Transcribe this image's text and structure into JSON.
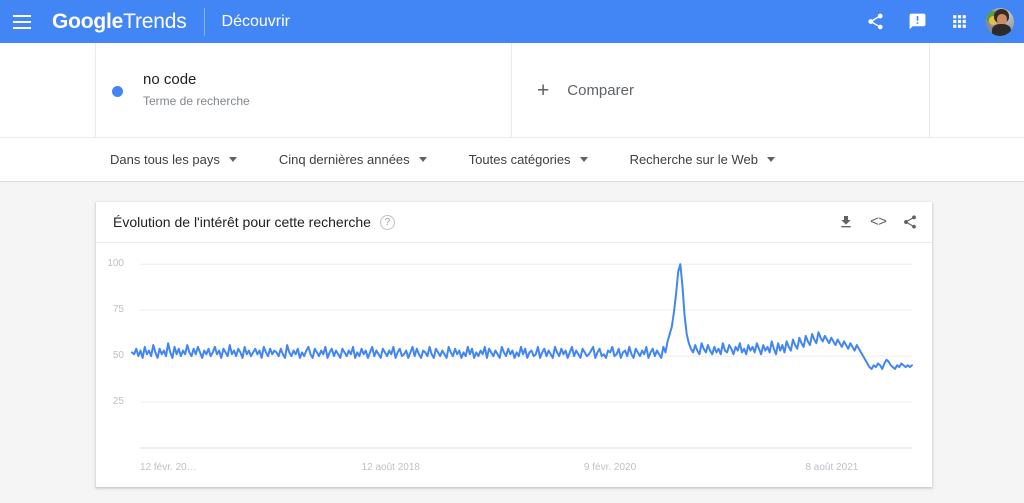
{
  "header": {
    "menu_icon": "hamburger-menu-icon",
    "brand_bold": "Google",
    "brand_light": "Trends",
    "discover_label": "Découvrir",
    "share_icon": "share-icon",
    "feedback_icon": "feedback-icon",
    "apps_icon": "apps-grid-icon",
    "avatar_icon": "user-avatar",
    "background_color": "#4285f4"
  },
  "search_term": {
    "title": "no code",
    "subtitle": "Terme de recherche",
    "dot_color": "#4285f4"
  },
  "compare": {
    "plus": "+",
    "label": "Comparer"
  },
  "filters": [
    {
      "label": "Dans tous les pays"
    },
    {
      "label": "Cinq dernières années"
    },
    {
      "label": "Toutes catégories"
    },
    {
      "label": "Recherche sur le Web"
    }
  ],
  "chart_card": {
    "title": "Évolution de l'intérêt pour cette recherche",
    "help_icon": "help-question-icon",
    "help_glyph": "?",
    "download_icon": "download-icon",
    "embed_icon": "embed-code-icon",
    "embed_glyph": "<>",
    "share_icon": "share-icon"
  },
  "chart_data": {
    "type": "line",
    "title": "Évolution de l'intérêt pour cette recherche",
    "xlabel": "",
    "ylabel": "",
    "ylim": [
      0,
      105
    ],
    "yticks": [
      100,
      75,
      50,
      25
    ],
    "grid": true,
    "legend": "none",
    "line_color": "#4285f4",
    "series_name": "no code",
    "xticks": [
      {
        "label": "12 févr. 20…",
        "position": 0.0
      },
      {
        "label": "12 août 2018",
        "position": 0.287
      },
      {
        "label": "9 févr. 2020",
        "position": 0.575
      },
      {
        "label": "8 août 2021",
        "position": 0.862
      }
    ],
    "x_start": "12 février 2017",
    "x_end": "février 2022",
    "values": [
      52,
      51,
      54,
      50,
      53,
      49,
      55,
      51,
      53,
      50,
      56,
      52,
      49,
      54,
      51,
      53,
      50,
      57,
      52,
      49,
      55,
      51,
      54,
      50,
      53,
      51,
      56,
      52,
      50,
      54,
      51,
      55,
      52,
      49,
      53,
      51,
      54,
      50,
      52,
      55,
      51,
      53,
      49,
      54,
      52,
      50,
      56,
      51,
      53,
      50,
      54,
      52,
      49,
      55,
      51,
      53,
      50,
      52,
      54,
      51,
      53,
      49,
      55,
      52,
      50,
      54,
      51,
      53,
      52,
      50,
      54,
      51,
      49,
      56,
      52,
      50,
      53,
      51,
      54,
      49,
      52,
      50,
      53,
      55,
      51,
      49,
      54,
      52,
      50,
      53,
      51,
      55,
      49,
      52,
      54,
      50,
      53,
      51,
      49,
      54,
      52,
      50,
      53,
      51,
      55,
      49,
      52,
      50,
      54,
      51,
      53,
      49,
      52,
      55,
      50,
      53,
      51,
      49,
      54,
      52,
      50,
      53,
      51,
      55,
      49,
      52,
      54,
      50,
      51,
      53,
      49,
      52,
      55,
      50,
      54,
      51,
      49,
      53,
      52,
      50,
      55,
      51,
      49,
      54,
      52,
      50,
      53,
      51,
      49,
      55,
      52,
      50,
      54,
      51,
      53,
      49,
      52,
      50,
      55,
      51,
      54,
      49,
      52,
      50,
      53,
      51,
      55,
      49,
      54,
      52,
      50,
      53,
      51,
      49,
      55,
      52,
      50,
      54,
      51,
      53,
      49,
      52,
      50,
      55,
      51,
      54,
      49,
      52,
      53,
      50,
      51,
      55,
      49,
      52,
      54,
      50,
      53,
      51,
      49,
      55,
      52,
      50,
      54,
      51,
      53,
      49,
      52,
      55,
      50,
      53,
      51,
      49,
      54,
      52,
      50,
      51,
      53,
      55,
      49,
      52,
      54,
      50,
      51,
      49,
      53,
      52,
      55,
      50,
      51,
      54,
      49,
      52,
      53,
      50,
      55,
      51,
      49,
      54,
      52,
      50,
      53,
      51,
      55,
      49,
      52,
      54,
      50,
      53,
      51,
      49,
      55,
      52,
      58,
      62,
      66,
      74,
      84,
      96,
      100,
      88,
      72,
      62,
      57,
      54,
      52,
      56,
      53,
      51,
      57,
      54,
      52,
      56,
      53,
      51,
      55,
      52,
      54,
      51,
      57,
      53,
      52,
      56,
      54,
      51,
      55,
      53,
      57,
      52,
      54,
      51,
      56,
      53,
      55,
      52,
      57,
      54,
      51,
      56,
      53,
      55,
      52,
      58,
      54,
      51,
      57,
      53,
      56,
      52,
      58,
      55,
      53,
      59,
      56,
      54,
      60,
      57,
      55,
      61,
      58,
      56,
      62,
      59,
      57,
      63,
      60,
      58,
      61,
      59,
      57,
      60,
      58,
      56,
      59,
      57,
      55,
      58,
      56,
      54,
      57,
      55,
      53,
      56,
      54,
      52,
      50,
      48,
      46,
      44,
      43,
      45,
      44,
      46,
      45,
      43,
      46,
      48,
      47,
      45,
      44,
      43,
      45,
      44,
      46,
      45,
      44,
      45,
      44,
      45
    ]
  }
}
